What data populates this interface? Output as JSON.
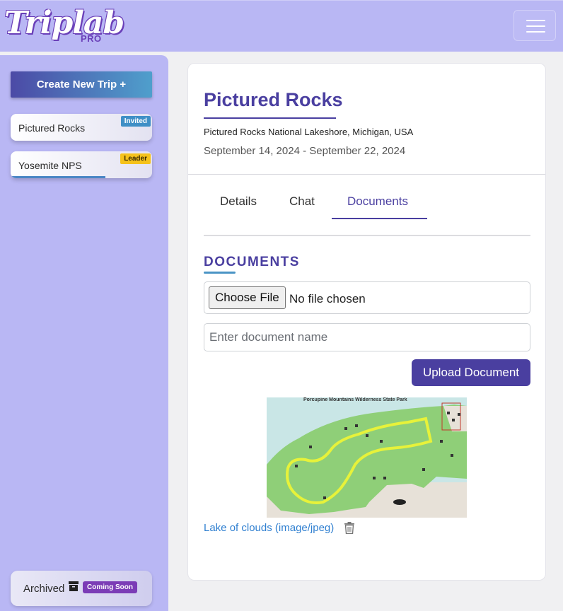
{
  "header": {
    "logo_text": "Triplab",
    "logo_sub": "PRO",
    "menu_icon": "hamburger-menu-icon"
  },
  "sidebar": {
    "create_label": "Create New Trip +",
    "trips": [
      {
        "name": "Pictured Rocks",
        "badge": "Invited",
        "badge_color": "#3f8fc6",
        "progress": 0
      },
      {
        "name": "Yosemite NPS",
        "badge": "Leader",
        "badge_color": "#f5c21b",
        "progress": 0.67
      }
    ],
    "archived": {
      "label": "Archived",
      "icon": "archive-box-icon",
      "badge": "Coming Soon",
      "badge_color": "#7b3cb6"
    }
  },
  "trip": {
    "title": "Pictured Rocks",
    "location": "Pictured Rocks National Lakeshore, Michigan, USA",
    "dates": "September 14, 2024 - September 22, 2024"
  },
  "tabs": [
    {
      "label": "Details",
      "active": false
    },
    {
      "label": "Chat",
      "active": false
    },
    {
      "label": "Documents",
      "active": true
    }
  ],
  "documents": {
    "heading": "DOCUMENTS",
    "choose_file_label": "Choose File",
    "no_file_text": "No file chosen",
    "name_placeholder": "Enter document name",
    "upload_label": "Upload Document",
    "items": [
      {
        "link_text": "Lake of clouds (image/jpeg)",
        "map_caption": "Porcupine Mountains Wilderness State Park",
        "delete_icon": "trash-icon"
      }
    ]
  },
  "colors": {
    "accent": "#4a3fa0",
    "header_bg": "#b9b7f4",
    "link": "#2f7fd0"
  }
}
